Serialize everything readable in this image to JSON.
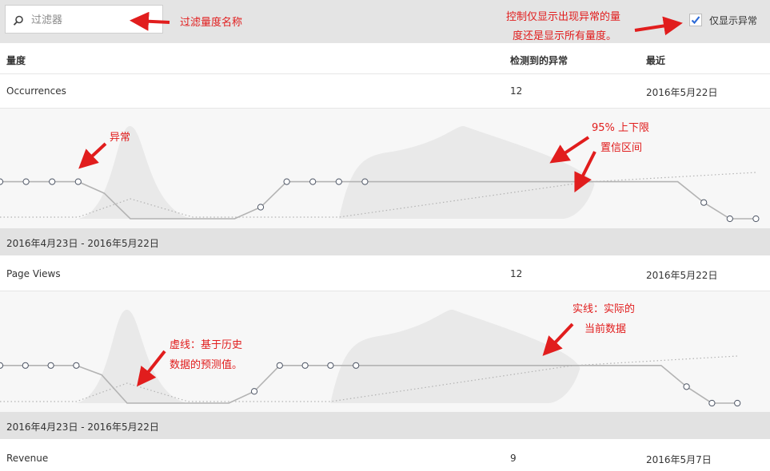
{
  "filter": {
    "placeholder": "过滤器"
  },
  "toggle": {
    "label": "仅显示异常",
    "checked": true
  },
  "table": {
    "headers": {
      "metric": "量度",
      "anomalies": "检测到的异常",
      "latest": "最近"
    },
    "rows": [
      {
        "metric": "Occurrences",
        "anomalies": "12",
        "latest": "2016年5月22日",
        "date_range": "2016年4月23日 - 2016年5月22日",
        "chart_data": {
          "type": "line",
          "actual": [
            0.8,
            0.8,
            0.8,
            0.8,
            0.55,
            0.0,
            0.0,
            0.0,
            0.0,
            0.0,
            0.25,
            0.8,
            0.8,
            0.8,
            0.8,
            0.8,
            0.8,
            0.8,
            0.8,
            0.8,
            0.8,
            0.8,
            0.8,
            0.8,
            0.8,
            0.8,
            0.8,
            0.35,
            0.0,
            0.0
          ],
          "markers": [
            true,
            true,
            true,
            true,
            false,
            false,
            false,
            false,
            false,
            false,
            true,
            true,
            true,
            true,
            true,
            false,
            false,
            false,
            false,
            false,
            false,
            false,
            false,
            false,
            false,
            false,
            false,
            true,
            true,
            true
          ]
        }
      },
      {
        "metric": "Page Views",
        "anomalies": "12",
        "latest": "2016年5月22日",
        "date_range": "2016年4月23日 - 2016年5月22日",
        "chart_data": {
          "type": "line",
          "actual": [
            0.8,
            0.8,
            0.8,
            0.8,
            0.6,
            0.0,
            0.0,
            0.0,
            0.0,
            0.0,
            0.25,
            0.8,
            0.8,
            0.8,
            0.8,
            0.8,
            0.8,
            0.8,
            0.8,
            0.8,
            0.8,
            0.8,
            0.8,
            0.8,
            0.8,
            0.8,
            0.8,
            0.35,
            0.0,
            0.0
          ],
          "markers": [
            true,
            true,
            true,
            true,
            false,
            false,
            false,
            false,
            false,
            false,
            true,
            true,
            true,
            true,
            true,
            false,
            false,
            false,
            false,
            false,
            false,
            false,
            false,
            false,
            false,
            false,
            false,
            true,
            true,
            true
          ]
        }
      },
      {
        "metric": "Revenue",
        "anomalies": "9",
        "latest": "2016年5月7日"
      }
    ]
  },
  "annotations": {
    "filter_note": "过滤量度名称",
    "toggle_note_1": "控制仅显示出现异常的量",
    "toggle_note_2": "度还是显示所有量度。",
    "anomaly": "异常",
    "confidence_1": "95% 上下限",
    "confidence_2": "置信区间",
    "actual_1": "实线：实际的",
    "actual_2": "当前数据",
    "predicted_1": "虚线：基于历史",
    "predicted_2": "数据的预测值。"
  },
  "colors": {
    "annotation": "#e11d1d",
    "line": "#b3b3b3",
    "band": "#e9e9e9",
    "check": "#2d6ad6"
  }
}
